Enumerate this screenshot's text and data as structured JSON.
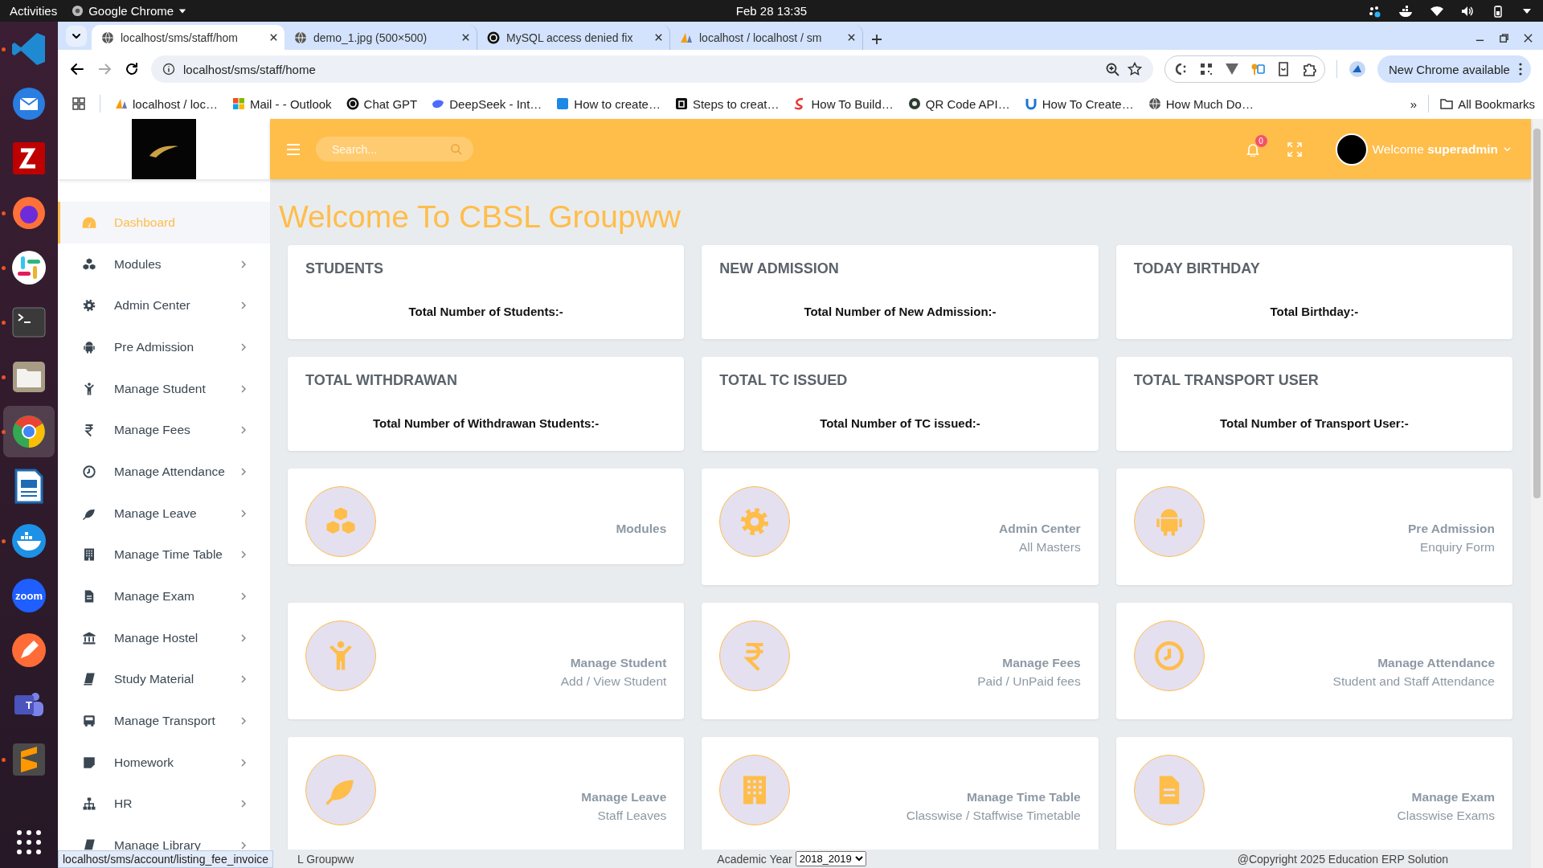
{
  "system_bar": {
    "activities": "Activities",
    "app_name": "Google Chrome",
    "clock": "Feb 28  13:35"
  },
  "dock": [
    {
      "kind": "vscode",
      "running": true,
      "selected": false
    },
    {
      "kind": "thunderbird",
      "running": false,
      "selected": false
    },
    {
      "kind": "filezilla",
      "running": false,
      "selected": false
    },
    {
      "kind": "firefox",
      "running": true,
      "selected": false
    },
    {
      "kind": "slack",
      "running": true,
      "selected": false
    },
    {
      "kind": "terminal",
      "running": true,
      "selected": false
    },
    {
      "kind": "files",
      "running": true,
      "selected": false
    },
    {
      "kind": "chrome",
      "running": true,
      "selected": true
    },
    {
      "kind": "writer",
      "running": false,
      "selected": false
    },
    {
      "kind": "docker",
      "running": true,
      "selected": false
    },
    {
      "kind": "zoom",
      "running": false,
      "selected": false,
      "label": "zoom"
    },
    {
      "kind": "postman",
      "running": false,
      "selected": false
    },
    {
      "kind": "teams",
      "running": false,
      "selected": false,
      "label": "T"
    },
    {
      "kind": "sublime",
      "running": true,
      "selected": false
    },
    {
      "kind": "apps",
      "running": false,
      "selected": false
    }
  ],
  "browser": {
    "tabs": [
      {
        "title": "localhost/sms/staff/hom",
        "kind": "globe",
        "selected": true
      },
      {
        "title": "demo_1.jpg (500×500)",
        "kind": "globe",
        "selected": false
      },
      {
        "title": "MySQL access denied fix",
        "kind": "chatgpt",
        "selected": false
      },
      {
        "title": "localhost / localhost / sm",
        "kind": "pma",
        "selected": false
      }
    ],
    "address": "localhost/sms/staff/home",
    "update_button": "New Chrome available",
    "bookmarks": [
      {
        "label": "localhost / loc…",
        "kind": "pma"
      },
      {
        "label": "Mail - - Outlook",
        "kind": "windows"
      },
      {
        "label": "Chat GPT",
        "kind": "chatgpt"
      },
      {
        "label": "DeepSeek - Int…",
        "kind": "deepseek"
      },
      {
        "label": "How to create…",
        "kind": "dn"
      },
      {
        "label": "Steps to creat…",
        "kind": "steps"
      },
      {
        "label": "How To Build…",
        "kind": "build"
      },
      {
        "label": "QR Code API…",
        "kind": "qr"
      },
      {
        "label": "How To Create…",
        "kind": "u"
      },
      {
        "label": "How Much Do…",
        "kind": "globe"
      }
    ],
    "bookmarks_overflow": "»",
    "all_bookmarks": "All Bookmarks",
    "hover_url": "localhost/sms/account/listing_fee_invoice"
  },
  "app": {
    "sidebar": [
      {
        "label": "Dashboard",
        "kind": "dashboard",
        "selected": true,
        "expandable": false
      },
      {
        "label": "Modules",
        "kind": "cubes",
        "selected": false,
        "expandable": true
      },
      {
        "label": "Admin Center",
        "kind": "cog",
        "selected": false,
        "expandable": true
      },
      {
        "label": "Pre Admission",
        "kind": "android",
        "selected": false,
        "expandable": true
      },
      {
        "label": "Manage Student",
        "kind": "child",
        "selected": false,
        "expandable": true
      },
      {
        "label": "Manage Fees",
        "kind": "rupee",
        "selected": false,
        "expandable": true
      },
      {
        "label": "Manage Attendance",
        "kind": "clock",
        "selected": false,
        "expandable": true
      },
      {
        "label": "Manage Leave",
        "kind": "leaf",
        "selected": false,
        "expandable": true
      },
      {
        "label": "Manage Time Table",
        "kind": "building",
        "selected": false,
        "expandable": true
      },
      {
        "label": "Manage Exam",
        "kind": "file",
        "selected": false,
        "expandable": true
      },
      {
        "label": "Manage Hostel",
        "kind": "bank",
        "selected": false,
        "expandable": true
      },
      {
        "label": "Study Material",
        "kind": "book",
        "selected": false,
        "expandable": true
      },
      {
        "label": "Manage Transport",
        "kind": "bus",
        "selected": false,
        "expandable": true
      },
      {
        "label": "Homework",
        "kind": "note",
        "selected": false,
        "expandable": true
      },
      {
        "label": "HR",
        "kind": "sitemap",
        "selected": false,
        "expandable": true
      },
      {
        "label": "Manage Library",
        "kind": "book",
        "selected": false,
        "expandable": true
      }
    ],
    "header": {
      "search_placeholder": "Search...",
      "notifications": "0",
      "greeting": "Welcome **superadmin**"
    },
    "title": "Welcome To CBSL Groupww",
    "stats": [
      {
        "title": "STUDENTS",
        "text": "Total Number of Students:-"
      },
      {
        "title": "NEW ADMISSION",
        "text": "Total Number of New Admission:-"
      },
      {
        "title": "TODAY BIRTHDAY",
        "text": "Total Birthday:-"
      },
      {
        "title": "TOTAL WITHDRAWAN",
        "text": "Total Number of Withdrawan Students:-"
      },
      {
        "title": "TOTAL TC ISSUED",
        "text": "Total Number of TC issued:-"
      },
      {
        "title": "TOTAL TRANSPORT USER",
        "text": "Total Number of Transport User:-"
      }
    ],
    "modules": [
      {
        "title": "Modules",
        "kind": "cubes"
      },
      {
        "title": "Admin Center",
        "subtitle": "All Masters",
        "kind": "cog"
      },
      {
        "title": "Pre Admission",
        "subtitle": "Enquiry Form",
        "kind": "android"
      },
      {
        "title": "Manage Student",
        "subtitle": "Add / View Student",
        "kind": "child"
      },
      {
        "title": "Manage Fees",
        "subtitle": "Paid / UnPaid fees",
        "kind": "rupee"
      },
      {
        "title": "Manage Attendance",
        "subtitle": "Student and Staff Attendance",
        "kind": "clock"
      },
      {
        "title": "Manage Leave",
        "subtitle": "Staff Leaves",
        "kind": "leaf"
      },
      {
        "title": "Manage Time Table",
        "subtitle": "Classwise / Staffwise Timetable",
        "kind": "building"
      },
      {
        "title": "Manage Exam",
        "subtitle": "Classwise Exams",
        "kind": "file"
      }
    ],
    "footer": {
      "left": "L Groupww",
      "year_label": "Academic Year",
      "year_value": "2018_2019",
      "copyright": "@Copyright 2025 Education ERP Solution"
    }
  }
}
